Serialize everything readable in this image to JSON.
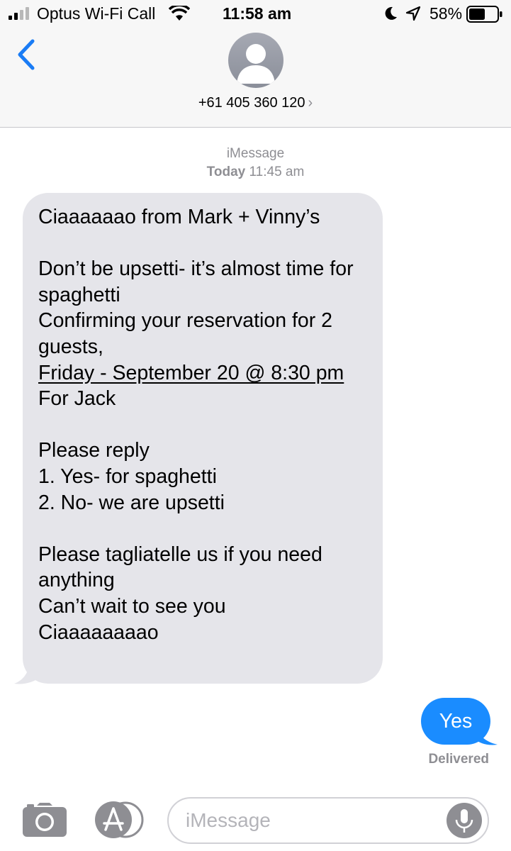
{
  "status_bar": {
    "carrier": "Optus Wi-Fi Call",
    "time": "11:58 am",
    "battery_percent": "58%",
    "battery_level": 0.58
  },
  "header": {
    "contact": "+61 405 360 120",
    "contact_chevron": "›",
    "back_icon": "chevron-left-icon",
    "avatar_icon": "person-silhouette-icon"
  },
  "conversation": {
    "service": "iMessage",
    "date_bold": "Today",
    "date_time": "11:45 am",
    "incoming": {
      "line1": "Ciaaaaaao from Mark + Vinny’s",
      "para2a": "Don’t be upsetti- it’s almost time for spaghetti",
      "para2b": "Confirming your reservation for 2 guests,",
      "para2c": "Friday - September 20 @ 8:30 pm",
      "para2d": "For Jack",
      "para3a": "Please reply",
      "para3b": "1. Yes- for spaghetti",
      "para3c": "2. No- we are upsetti",
      "para4a": "Please tagliatelle us if you need anything",
      "para4b": "Can’t wait to see you",
      "para4c": "Ciaaaaaaaao"
    },
    "outgoing": {
      "text": "Yes",
      "status": "Delivered"
    }
  },
  "input_bar": {
    "placeholder": "iMessage",
    "camera_icon": "camera-icon",
    "apps_icon": "app-store-icon",
    "mic_icon": "microphone-icon"
  },
  "colors": {
    "incoming_bubble": "#e5e5ea",
    "outgoing_bubble": "#1a8cff",
    "accent": "#1a7cf5",
    "secondary_text": "#8e8e93"
  }
}
